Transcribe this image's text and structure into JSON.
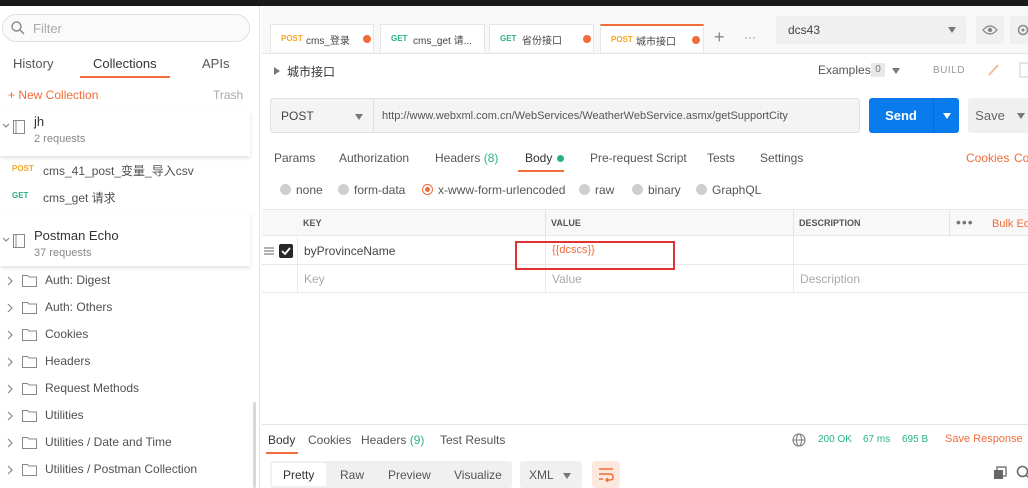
{
  "sidebar": {
    "filter_placeholder": "Filter",
    "tabs": [
      {
        "label": "History"
      },
      {
        "label": "Collections"
      },
      {
        "label": "APIs"
      }
    ],
    "new_collection": "+ New Collection",
    "trash": "Trash",
    "collections": [
      {
        "name": "jh",
        "count": "2 requests"
      },
      {
        "name": "Postman Echo",
        "count": "37 requests"
      }
    ],
    "requests": [
      {
        "method": "POST",
        "name": "cms_41_post_变量_导入csv"
      },
      {
        "method": "GET",
        "name": "cms_get 请求"
      }
    ],
    "folders": [
      "Auth: Digest",
      "Auth: Others",
      "Cookies",
      "Headers",
      "Request Methods",
      "Utilities",
      "Utilities / Date and Time",
      "Utilities / Postman Collection"
    ]
  },
  "tabs": [
    {
      "method": "POST",
      "title": "cms_登录"
    },
    {
      "method": "GET",
      "title": "cms_get 请..."
    },
    {
      "method": "GET",
      "title": "省份接口"
    },
    {
      "method": "POST",
      "title": "城市接口"
    }
  ],
  "more_tabs": "···",
  "environment": {
    "value": "dcs43"
  },
  "request": {
    "title": "城市接口",
    "examples_label": "Examples",
    "examples_count": "0",
    "build_label": "BUILD",
    "method": "POST",
    "url": "http://www.webxml.com.cn/WebServices/WeatherWebService.asmx/getSupportCity",
    "send_label": "Send",
    "save_label": "Save"
  },
  "request_tabs": {
    "params": "Params",
    "authorization": "Authorization",
    "headers": "Headers",
    "headers_count": "(8)",
    "body": "Body",
    "prerequest": "Pre-request Script",
    "tests": "Tests",
    "settings": "Settings",
    "cookies": "Cookies",
    "code": "Code"
  },
  "body_types": {
    "none": "none",
    "form_data": "form-data",
    "urlencoded": "x-www-form-urlencoded",
    "raw": "raw",
    "binary": "binary",
    "graphql": "GraphQL",
    "selected": "x-www-form-urlencoded"
  },
  "kv_table": {
    "headers": {
      "key": "KEY",
      "value": "VALUE",
      "description": "DESCRIPTION",
      "bulk_edit": "Bulk Edit"
    },
    "row": {
      "key": "byProvinceName",
      "value": "{{dcscs}}"
    },
    "placeholders": {
      "key": "Key",
      "value": "Value",
      "description": "Description"
    }
  },
  "response": {
    "tabs": {
      "body": "Body",
      "cookies": "Cookies",
      "headers": "Headers",
      "headers_count": "(9)",
      "test_results": "Test Results"
    },
    "status": "200 OK",
    "time": "67 ms",
    "size": "695 B",
    "save_label": "Save Response",
    "formats": {
      "pretty": "Pretty",
      "raw": "Raw",
      "preview": "Preview",
      "visualize": "Visualize"
    },
    "language": "XML"
  },
  "colors": {
    "accent": "#f26b3a",
    "primary": "#097bed",
    "success": "#26b47f",
    "post": "#f5a623",
    "get": "#26b47f",
    "highlight": "#e03232"
  }
}
